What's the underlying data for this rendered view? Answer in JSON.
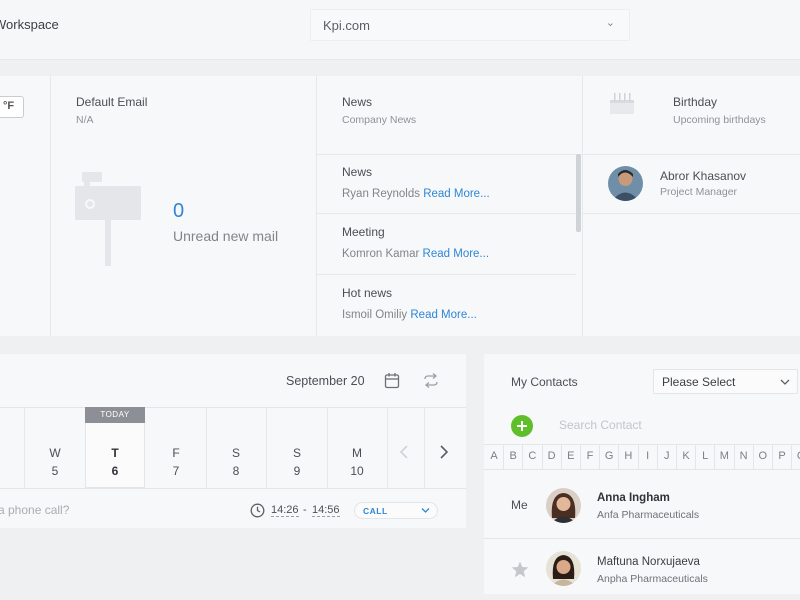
{
  "topbar": {
    "workspace_label": "Workspace",
    "domain_value": "Kpi.com",
    "domain_caret": "⌄"
  },
  "weather": {
    "unit_button": "°F"
  },
  "email": {
    "title": "Default Email",
    "value": "N/A",
    "unread_count": "0",
    "unread_label": "Unread new mail"
  },
  "news": {
    "title": "News",
    "subtitle": "Company News",
    "items": [
      {
        "title": "News",
        "author": "Ryan Reynolds",
        "link": "Read More..."
      },
      {
        "title": "Meeting",
        "author": "Komron Kamar",
        "link": "Read More..."
      },
      {
        "title": "Hot news",
        "author": "Ismoil Omiliy",
        "link": "Read More..."
      }
    ]
  },
  "birthday": {
    "title": "Birthday",
    "subtitle": "Upcoming birthdays",
    "person_name": "Abror Khasanov",
    "person_role": "Project Manager"
  },
  "calendar": {
    "month_label": "September 20",
    "today_tag": "TODAY",
    "days": [
      {
        "w": "W",
        "n": "5"
      },
      {
        "w": "T",
        "n": "6"
      },
      {
        "w": "F",
        "n": "7"
      },
      {
        "w": "S",
        "n": "8"
      },
      {
        "w": "S",
        "n": "9"
      },
      {
        "w": "M",
        "n": "10"
      }
    ],
    "call_placeholder": "a phone call?",
    "time_from": "14:26",
    "time_sep": "-",
    "time_to": "14:56",
    "call_type": "CALL"
  },
  "contacts": {
    "title": "My Contacts",
    "select_value": "Please Select",
    "search_placeholder": "Search Contact",
    "letters": [
      "A",
      "B",
      "C",
      "D",
      "E",
      "F",
      "G",
      "H",
      "I",
      "J",
      "K",
      "L",
      "M",
      "N",
      "O",
      "P",
      "Q"
    ],
    "me_label": "Me",
    "list": [
      {
        "name": "Anna Ingham",
        "company": "Anfa Pharmaceuticals"
      },
      {
        "name": "Maftuna Norxujaeva",
        "company": "Anpha Pharmaceuticals"
      }
    ]
  },
  "colors": {
    "accent": "#2f86d6",
    "add_green": "#5fbf2a"
  }
}
